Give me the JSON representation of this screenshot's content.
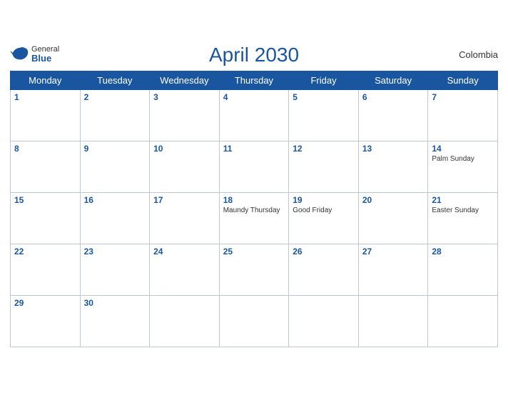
{
  "header": {
    "logo_general": "General",
    "logo_blue": "Blue",
    "title": "April 2030",
    "country": "Colombia"
  },
  "weekdays": [
    "Monday",
    "Tuesday",
    "Wednesday",
    "Thursday",
    "Friday",
    "Saturday",
    "Sunday"
  ],
  "weeks": [
    [
      {
        "day": "1",
        "holiday": ""
      },
      {
        "day": "2",
        "holiday": ""
      },
      {
        "day": "3",
        "holiday": ""
      },
      {
        "day": "4",
        "holiday": ""
      },
      {
        "day": "5",
        "holiday": ""
      },
      {
        "day": "6",
        "holiday": ""
      },
      {
        "day": "7",
        "holiday": ""
      }
    ],
    [
      {
        "day": "8",
        "holiday": ""
      },
      {
        "day": "9",
        "holiday": ""
      },
      {
        "day": "10",
        "holiday": ""
      },
      {
        "day": "11",
        "holiday": ""
      },
      {
        "day": "12",
        "holiday": ""
      },
      {
        "day": "13",
        "holiday": ""
      },
      {
        "day": "14",
        "holiday": "Palm Sunday"
      }
    ],
    [
      {
        "day": "15",
        "holiday": ""
      },
      {
        "day": "16",
        "holiday": ""
      },
      {
        "day": "17",
        "holiday": ""
      },
      {
        "day": "18",
        "holiday": "Maundy Thursday"
      },
      {
        "day": "19",
        "holiday": "Good Friday"
      },
      {
        "day": "20",
        "holiday": ""
      },
      {
        "day": "21",
        "holiday": "Easter Sunday"
      }
    ],
    [
      {
        "day": "22",
        "holiday": ""
      },
      {
        "day": "23",
        "holiday": ""
      },
      {
        "day": "24",
        "holiday": ""
      },
      {
        "day": "25",
        "holiday": ""
      },
      {
        "day": "26",
        "holiday": ""
      },
      {
        "day": "27",
        "holiday": ""
      },
      {
        "day": "28",
        "holiday": ""
      }
    ],
    [
      {
        "day": "29",
        "holiday": ""
      },
      {
        "day": "30",
        "holiday": ""
      },
      {
        "day": "",
        "holiday": ""
      },
      {
        "day": "",
        "holiday": ""
      },
      {
        "day": "",
        "holiday": ""
      },
      {
        "day": "",
        "holiday": ""
      },
      {
        "day": "",
        "holiday": ""
      }
    ]
  ]
}
